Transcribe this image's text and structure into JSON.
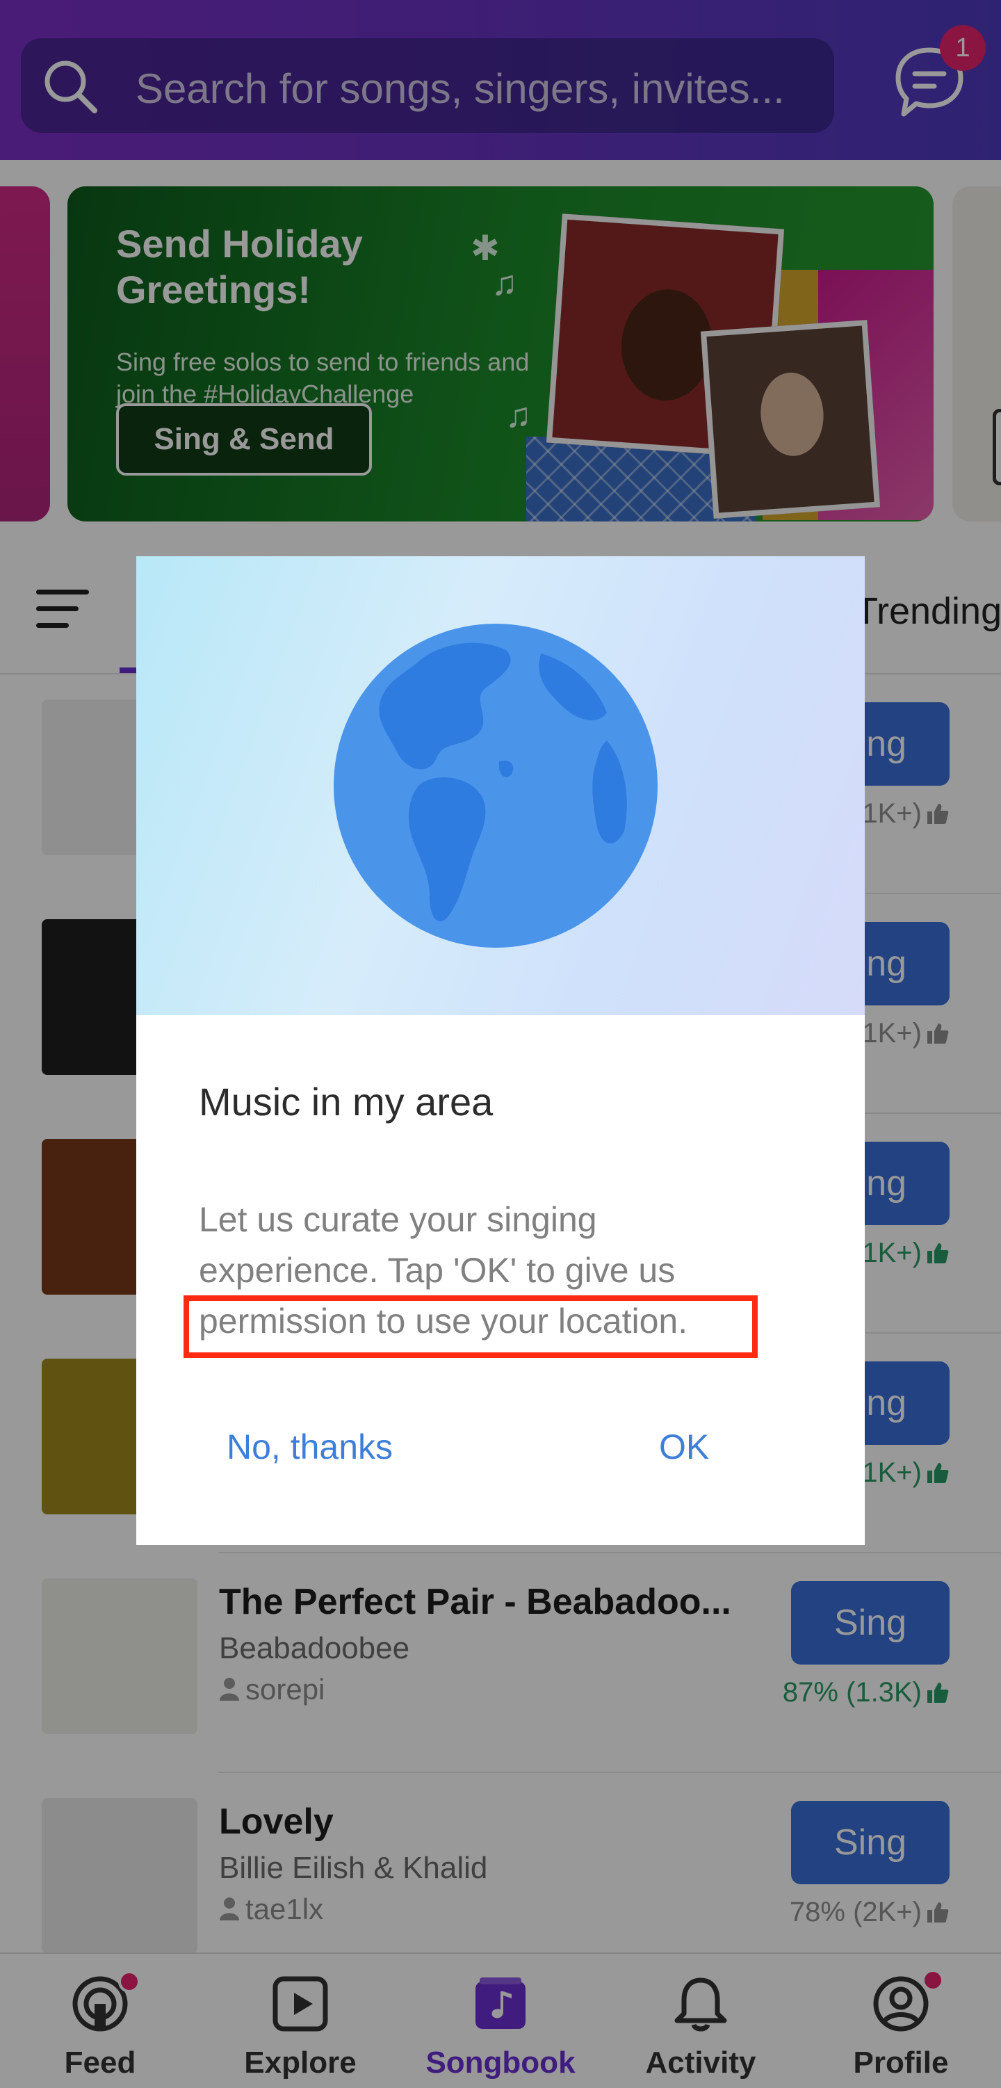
{
  "search": {
    "placeholder": "Search for songs, singers, invites..."
  },
  "chat": {
    "badge_count": "1"
  },
  "banner": {
    "title": "Send Holiday Greetings!",
    "text": "Sing free solos to send to friends and join the #HolidayChallenge",
    "button_label": "Sing & Send",
    "background_color": "#1c8a2a"
  },
  "tabs": {
    "trending_label": "Trending"
  },
  "songs": [
    {
      "title": "",
      "artist": "",
      "user": "",
      "sing_label": "Sing",
      "rating": "(1K+)",
      "rating_style": "gray",
      "thumb_color": "#eeeeee"
    },
    {
      "title": "",
      "artist": "",
      "user": "",
      "sing_label": "Sing",
      "rating": "(1K+)",
      "rating_style": "gray",
      "thumb_color": "#1f1f1f"
    },
    {
      "title": "",
      "artist": "",
      "user": "",
      "sing_label": "Sing",
      "rating": "(1K+)",
      "rating_style": "green",
      "thumb_color": "#7a3a1a"
    },
    {
      "title": "",
      "artist": "",
      "user": "",
      "sing_label": "Sing",
      "rating": "(1K+)",
      "rating_style": "green",
      "thumb_color": "#a08a1e"
    },
    {
      "title": "The Perfect Pair - Beabadoo...",
      "artist": "Beabadoobee",
      "user": "sorepi",
      "sing_label": "Sing",
      "rating": "87% (1.3K)",
      "rating_style": "green",
      "thumb_color": "#efeeea"
    },
    {
      "title": "Lovely",
      "artist": "Billie Eilish & Khalid",
      "user": "tae1lx",
      "sing_label": "Sing",
      "rating": "78% (2K+)",
      "rating_style": "gray",
      "thumb_color": "#e9e9e9"
    }
  ],
  "bottom_nav": {
    "items": [
      {
        "label": "Feed",
        "icon": "feed-icon",
        "active": false,
        "badge": true
      },
      {
        "label": "Explore",
        "icon": "play-icon",
        "active": false,
        "badge": false
      },
      {
        "label": "Songbook",
        "icon": "songbook-icon",
        "active": true,
        "badge": false
      },
      {
        "label": "Activity",
        "icon": "bell-icon",
        "active": false,
        "badge": false
      },
      {
        "label": "Profile",
        "icon": "profile-icon",
        "active": false,
        "badge": true
      }
    ],
    "active_color": "#6a2fd0"
  },
  "dialog": {
    "title": "Music in my area",
    "body_line1": "Let us curate your singing",
    "body_line2": "experience. Tap 'OK' to give us",
    "body_line3": "permission to use your location.",
    "negative_label": "No,  thanks",
    "positive_label": "OK",
    "highlight_color": "#ff2a12"
  }
}
